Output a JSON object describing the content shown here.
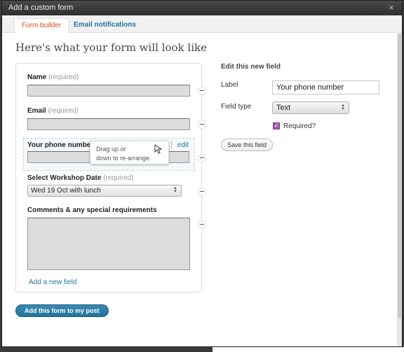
{
  "dialog": {
    "title": "Add a custom form",
    "close_glyph": "×"
  },
  "tabs": [
    {
      "label": "Form builder",
      "active": true
    },
    {
      "label": "Email notifications",
      "active": false
    }
  ],
  "preview": {
    "heading": "Here's what your form will look like",
    "fields": [
      {
        "label": "Name",
        "required_text": "(required)"
      },
      {
        "label": "Email",
        "required_text": "(required)"
      },
      {
        "label": "Your phone number",
        "edit_link": "edit"
      },
      {
        "label": "Select Workshop Date",
        "required_text": "(required)",
        "selected_option": "Wed 19 Oct with lunch"
      },
      {
        "label": "Comments & any special requirements"
      }
    ],
    "add_field_link": "Add a new field",
    "tooltip_line1": "Drag up or",
    "tooltip_line2": "down to re-arrange."
  },
  "edit_panel": {
    "title": "Edit this new field",
    "label_caption": "Label",
    "label_value": "Your phone number",
    "type_caption": "Field type",
    "type_value": "Text",
    "required_caption": "Required?",
    "required_checked": true,
    "save_button": "Save this field"
  },
  "footer": {
    "add_form_button": "Add this form to my post"
  },
  "colors": {
    "accent_link": "#21759b",
    "active_tab": "#d54e21",
    "checkbox": "#a35bb5"
  }
}
